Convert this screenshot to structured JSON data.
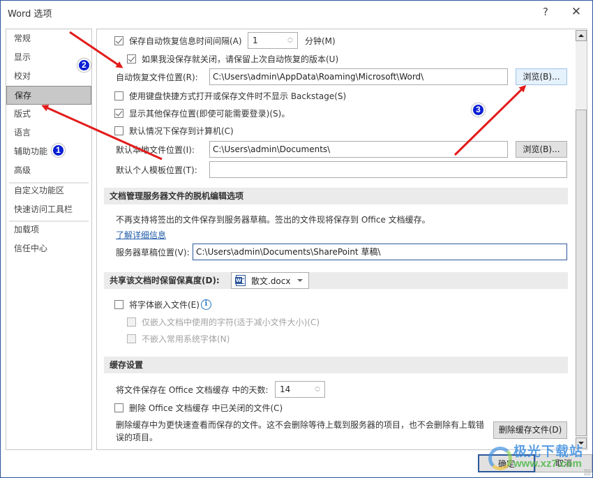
{
  "window": {
    "title": "Word 选项",
    "help_label": "?",
    "close_label": "✕"
  },
  "nav": {
    "items": [
      {
        "label": "常规",
        "active": false
      },
      {
        "label": "显示",
        "active": false
      },
      {
        "label": "校对",
        "active": false
      },
      {
        "label": "保存",
        "active": true
      },
      {
        "label": "版式",
        "active": false
      },
      {
        "label": "语言",
        "active": false
      },
      {
        "label": "辅助功能",
        "active": false
      },
      {
        "label": "高级",
        "active": false
      },
      {
        "label": "自定义功能区",
        "active": false
      },
      {
        "label": "快速访问工具栏",
        "active": false
      },
      {
        "label": "加载项",
        "active": false
      },
      {
        "label": "信任中心",
        "active": false
      }
    ]
  },
  "save": {
    "autorecover_interval": {
      "label": "保存自动恢复信息时间间隔(A)",
      "checked": true,
      "value": "1",
      "unit": "分钟(M)"
    },
    "keep_last_version": {
      "label": "如果我没保存就关闭，请保留上次自动恢复的版本(U)",
      "checked": true
    },
    "autorecover_location": {
      "label": "自动恢复文件位置(R):",
      "value": "C:\\Users\\admin\\AppData\\Roaming\\Microsoft\\Word\\",
      "browse": "浏览(B)..."
    },
    "no_backstage": {
      "label": "使用键盘快捷方式打开或保存文件时不显示 Backstage(S)",
      "checked": false
    },
    "show_other_locations": {
      "label": "显示其他保存位置(即使可能需要登录)(S)。",
      "checked": true
    },
    "save_to_computer": {
      "label": "默认情况下保存到计算机(C)",
      "checked": false
    },
    "default_local_location": {
      "label": "默认本地文件位置(I):",
      "value": "C:\\Users\\admin\\Documents\\",
      "browse": "浏览(B)..."
    },
    "default_template_location": {
      "label": "默认个人模板位置(T):",
      "value": ""
    }
  },
  "offline": {
    "header": "文档管理服务器文件的脱机编辑选项",
    "notice": "不再支持将签出的文件保存到服务器草稿。签出的文件现将保存到 Office 文档缓存。",
    "learn_more": "了解详细信息",
    "drafts_location": {
      "label": "服务器草稿位置(V):",
      "value": "C:\\Users\\admin\\Documents\\SharePoint 草稿\\"
    }
  },
  "fidelity": {
    "header": "共享该文档时保留保真度(D):",
    "document": "散文.docx",
    "embed_fonts": {
      "label": "将字体嵌入文件(E)",
      "checked": false
    },
    "embed_used_chars": {
      "label": "仅嵌入文档中使用的字符(适于减小文件大小)(C)",
      "checked": false,
      "disabled": true
    },
    "no_common_fonts": {
      "label": "不嵌入常用系统字体(N)",
      "checked": false,
      "disabled": true
    },
    "info_icon": "i"
  },
  "cache": {
    "header": "缓存设置",
    "days": {
      "label": "将文件保存在 Office 文档缓存 中的天数:",
      "value": "14"
    },
    "delete_closed": {
      "label": "删除 Office 文档缓存 中已关闭的文件(C)",
      "checked": false
    },
    "description_line1": "删除缓存中为更快速查看而保存的文件。这不会删除等待上载到服务器的项目，也不会删除有上载错",
    "description_line2": "误的项目。",
    "delete_button": "删除缓存文件(D)"
  },
  "footer": {
    "ok": "确定",
    "cancel": "取消"
  },
  "annotations": {
    "badges": [
      "1",
      "2",
      "3"
    ],
    "color": "#e31b1b"
  },
  "watermark": {
    "name": "极光下载站",
    "url": "www.xz7.com"
  }
}
